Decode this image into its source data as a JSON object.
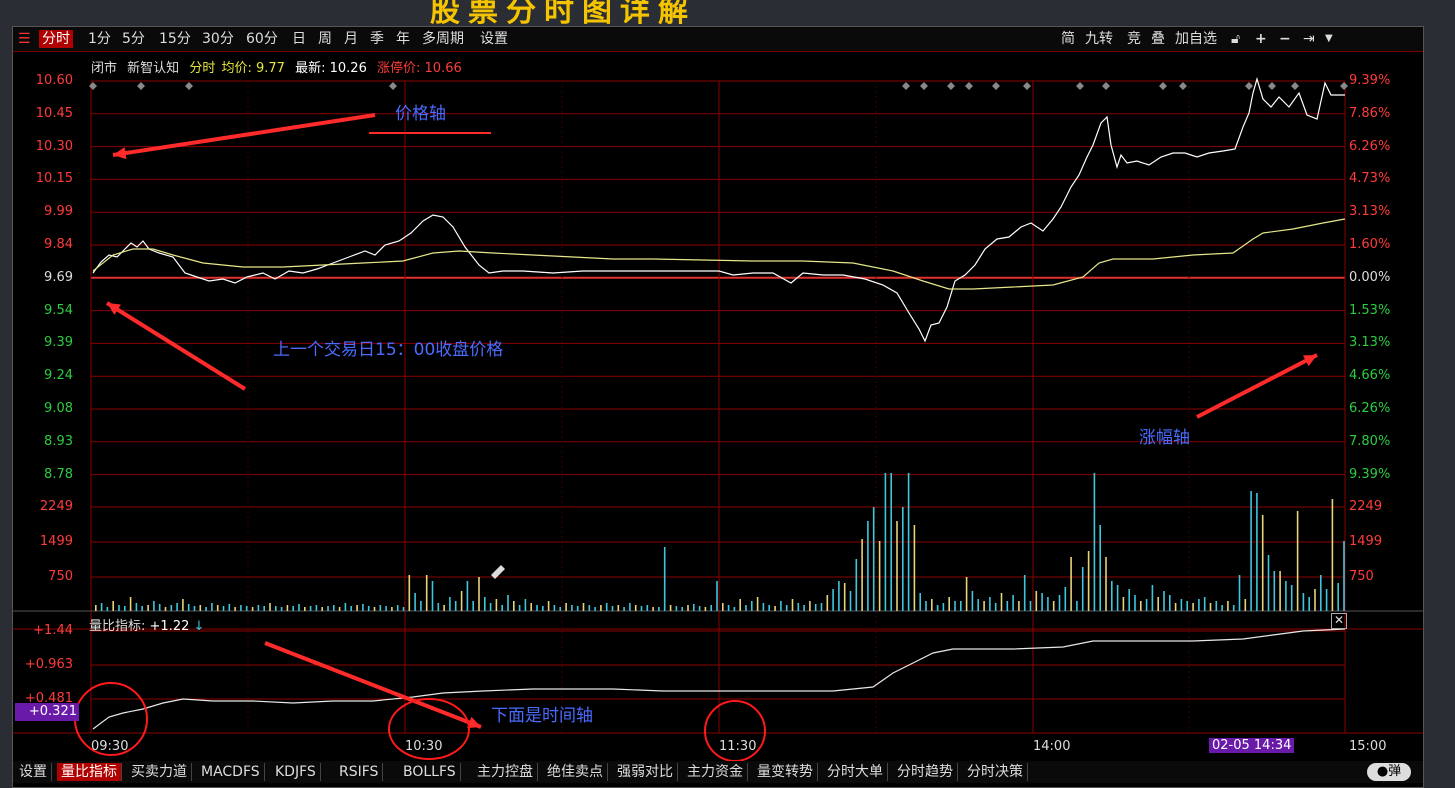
{
  "banner_text": "股票分时图详解",
  "toolbar": {
    "periods": [
      "分时",
      "1分",
      "5分",
      "15分",
      "30分",
      "60分",
      "日",
      "周",
      "月",
      "季",
      "年",
      "多周期",
      "设置"
    ],
    "active_index": 0,
    "right_items": [
      "简",
      "九转",
      "竞",
      "叠",
      "加自选"
    ]
  },
  "info": {
    "status": "闭市",
    "name": "新智认知",
    "mode": "分时",
    "avg_label": "均价:",
    "avg_value": "9.77",
    "latest_label": "最新:",
    "latest_value": "10.26",
    "limit_label": "涨停价:",
    "limit_value": "10.66"
  },
  "price_axis": [
    "10.60",
    "10.45",
    "10.30",
    "10.15",
    "9.99",
    "9.84",
    "9.69",
    "9.54",
    "9.39",
    "9.24",
    "9.08",
    "8.93",
    "8.78"
  ],
  "pct_axis": [
    "9.39%",
    "7.86%",
    "6.26%",
    "4.73%",
    "3.13%",
    "1.60%",
    "0.00%",
    "1.53%",
    "3.13%",
    "4.66%",
    "6.26%",
    "7.80%",
    "9.39%"
  ],
  "volume_axis": [
    "2249",
    "1499",
    "750"
  ],
  "ratio": {
    "label": "量比指标:",
    "value": "+1.22",
    "arrow": "↓",
    "axis": [
      "+1.44",
      "+0.963",
      "+0.481"
    ],
    "current_marker": "+0.321"
  },
  "time_axis": [
    "09:30",
    "10:30",
    "11:30",
    "14:00",
    "15:00"
  ],
  "cursor_time": "02-05 14:34",
  "bottom_tabs": [
    "设置",
    "量比指标",
    "买卖力道",
    "MACDFS",
    "KDJFS",
    "RSIFS",
    "BOLLFS",
    "主力控盘",
    "绝佳卖点",
    "强弱对比",
    "主力资金",
    "量变转势",
    "分时大单",
    "分时趋势",
    "分时决策"
  ],
  "bottom_active_index": 1,
  "bottom_right_label": "弹",
  "annotations": {
    "price_axis": "价格轴",
    "prev_close": "上一个交易日15：00收盘价格",
    "pct_axis": "涨幅轴",
    "time_axis": "下面是时间轴"
  },
  "colors": {
    "up": "#ff3b3b",
    "down": "#2ecc40",
    "grid": "#8a0000",
    "price_line": "#ffffff",
    "avg_line": "#e6e68a",
    "vol_up": "#e6d37a",
    "vol_down": "#3fc6dc",
    "annotation": "#4a6bff",
    "arrow": "#ff2a2a",
    "marker": "#6a1aa8"
  }
}
